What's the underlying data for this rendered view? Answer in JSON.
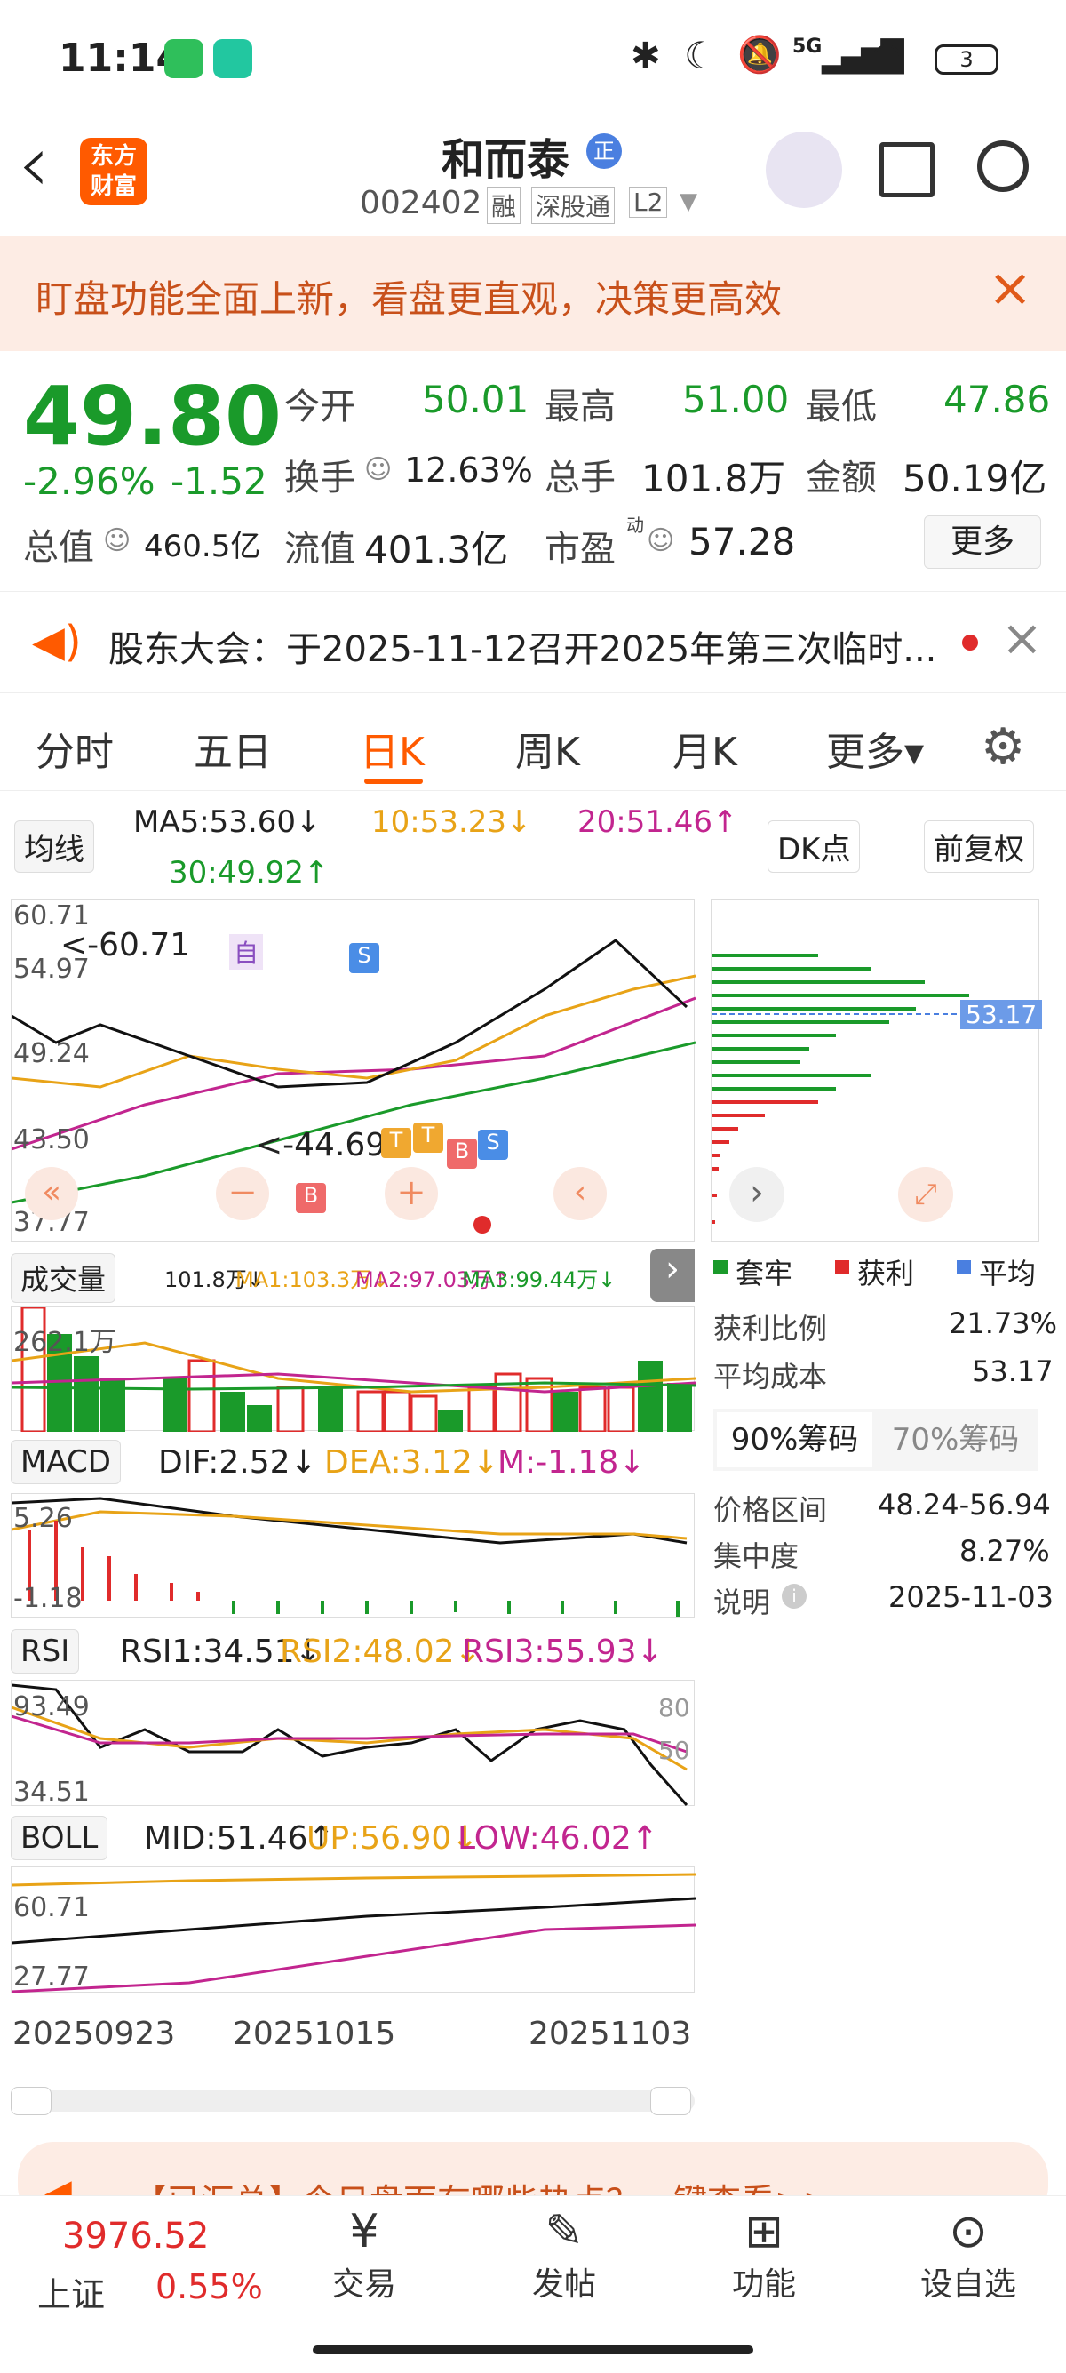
{
  "status": {
    "time": "11:14",
    "battery": "3",
    "network": "5G"
  },
  "header": {
    "back": "‹",
    "logo": "东方财富",
    "name": "和而泰",
    "badge": "正",
    "code": "002402",
    "tags": [
      "融",
      "深股通",
      "L2"
    ]
  },
  "banner": {
    "text": "盯盘功能全面上新，看盘更直观，决策更高效",
    "close": "×"
  },
  "quote": {
    "price": "49.80",
    "pct": "-2.96%",
    "chg": "-1.52",
    "open_l": "今开",
    "open": "50.01",
    "high_l": "最高",
    "high": "51.00",
    "low_l": "最低",
    "low": "47.86",
    "turn_l": "换手",
    "turn": "12.63%",
    "vol_l": "总手",
    "vol": "101.8万",
    "amt_l": "金额",
    "amt": "50.19亿",
    "mcap_l": "总值",
    "mcap": "460.5亿",
    "float_l": "流值",
    "float": "401.3亿",
    "pe_l": "市盈",
    "pe_sup": "动",
    "pe": "57.28",
    "more": "更多"
  },
  "notice": {
    "text": "股东大会：于2025-11-12召开2025年第三次临时...",
    "close": "×"
  },
  "tabs": [
    "分时",
    "五日",
    "日K",
    "周K",
    "月K",
    "更多▾"
  ],
  "ma": {
    "select": "均线",
    "ma5": "MA5:53.60↓",
    "ma10": "10:53.23↓",
    "ma20": "20:51.46↑",
    "ma30": "30:49.92↑",
    "dk": "DK点",
    "adj": "前复权"
  },
  "kchart": {
    "y_ticks": [
      "60.71",
      "54.97",
      "49.24",
      "43.50",
      "37.77"
    ],
    "hi_label": "<-60.71",
    "lo_label": "<-44.69",
    "marks": [
      "自",
      "S",
      "B",
      "S",
      "T",
      "T",
      "B",
      "S"
    ]
  },
  "volume": {
    "select": "成交量",
    "v": "101.8万↓",
    "ma1": "MA1:103.3万↓",
    "ma2": "MA2:97.03万↑",
    "ma3": "MA3:99.44万↓",
    "tick": "262.1万"
  },
  "macd": {
    "select": "MACD",
    "dif": "DIF:2.52↓",
    "dea": "DEA:3.12↓",
    "m": "M:-1.18↓",
    "t1": "5.26",
    "t2": "-1.18"
  },
  "rsi": {
    "select": "RSI",
    "r1": "RSI1:34.51↓",
    "r2": "RSI2:48.02↓",
    "r3": "RSI3:55.93↓",
    "t1": "93.49",
    "t2": "34.51",
    "h80": "80",
    "h50": "50"
  },
  "boll": {
    "select": "BOLL",
    "mid": "MID:51.46↑",
    "up": "UP:56.90↓",
    "low": "LOW:46.02↑",
    "t1": "60.71",
    "t2": "27.77"
  },
  "dates": [
    "20250923",
    "20251015",
    "20251103"
  ],
  "chips": {
    "legend": [
      "套牢",
      "获利",
      "平均"
    ],
    "price": "53.17",
    "profit_l": "获利比例",
    "profit": "21.73%",
    "cost_l": "平均成本",
    "cost": "53.17",
    "tab90": "90%筹码",
    "tab70": "70%筹码",
    "range_l": "价格区间",
    "range": "48.24-56.94",
    "conc_l": "集中度",
    "conc": "8.27%",
    "note_l": "说明",
    "note": "2025-11-03"
  },
  "promo": {
    "text": "【已汇总】今日盘面有哪些热点？一键查看>>"
  },
  "bottom": {
    "index": "3976.52",
    "index_name": "上证",
    "index_pct": "0.55%",
    "items": [
      "交易",
      "发帖",
      "功能",
      "设自选"
    ]
  },
  "colors": {
    "up": "#e02b2b",
    "down": "#1a9a2a",
    "ma5": "#111111",
    "ma10": "#e8a317",
    "ma20": "#c2258f",
    "ma30": "#1a9a2a",
    "accent": "#ff5a00"
  }
}
